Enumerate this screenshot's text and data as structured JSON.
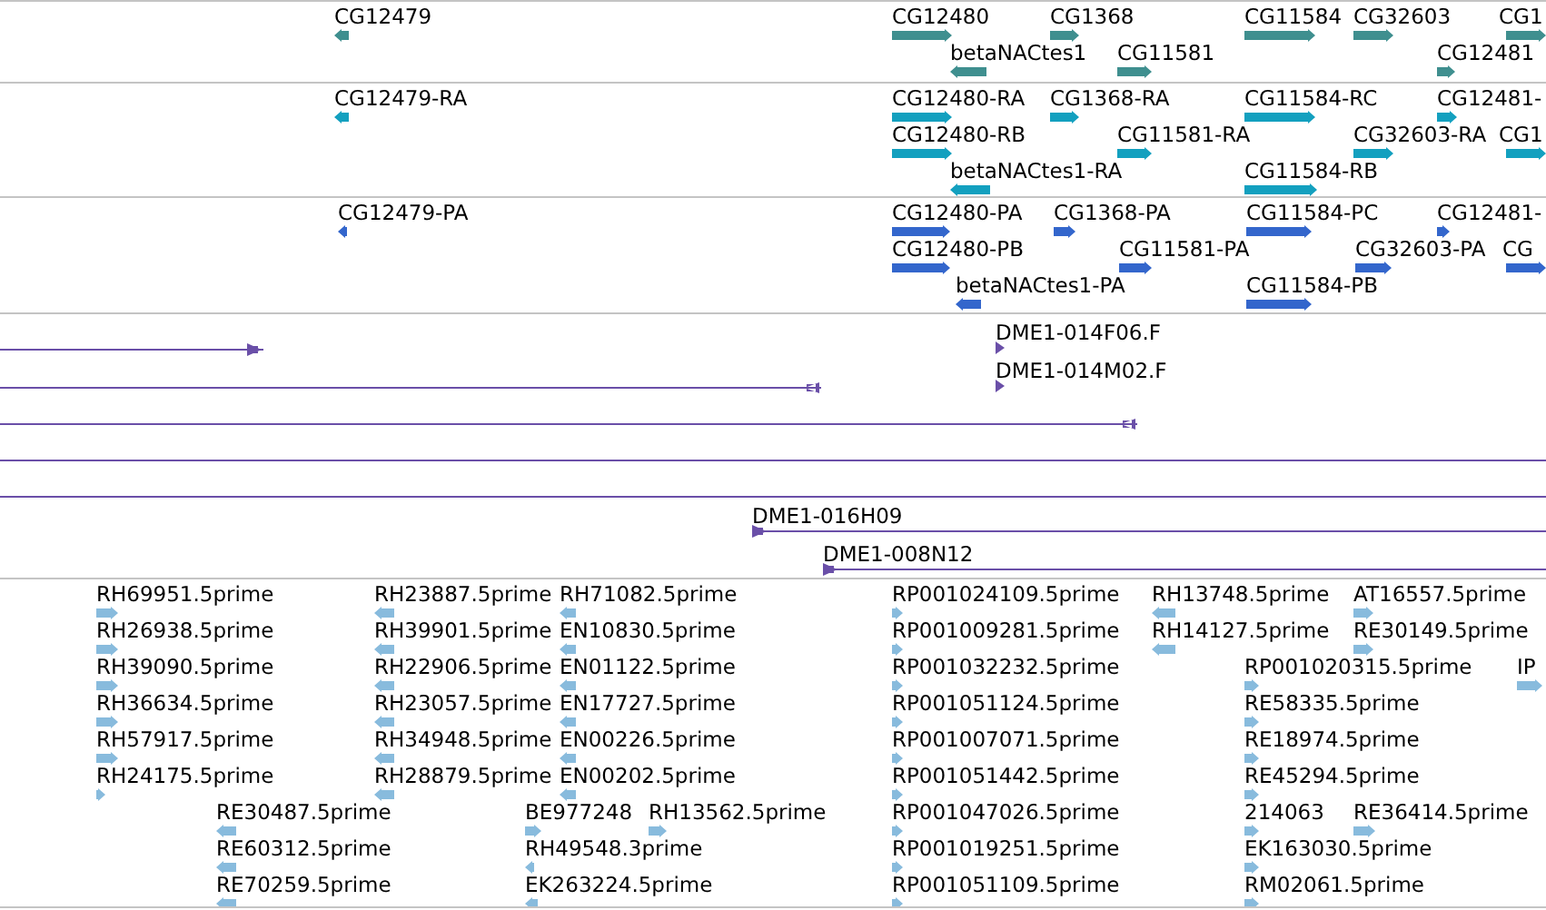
{
  "tracks": [
    {
      "kind": "gene",
      "color": "#3f8f8f",
      "features": [
        {
          "label": "CG12479",
          "reverse": true
        },
        {
          "label": "CG12480",
          "reverse": false
        },
        {
          "label": "CG1368",
          "reverse": false
        },
        {
          "label": "CG11584",
          "reverse": false
        },
        {
          "label": "CG32603",
          "reverse": false
        },
        {
          "label": "CG1",
          "reverse": false
        },
        {
          "label": "betaNACtes1",
          "reverse": true
        },
        {
          "label": "CG11581",
          "reverse": false
        },
        {
          "label": "CG12481",
          "reverse": false
        }
      ]
    },
    {
      "kind": "gene",
      "color": "#13a0bf",
      "features": [
        {
          "label": "CG12479-RA",
          "reverse": true
        },
        {
          "label": "CG12480-RA",
          "reverse": false
        },
        {
          "label": "CG1368-RA",
          "reverse": false
        },
        {
          "label": "CG11584-RC",
          "reverse": false
        },
        {
          "label": "CG12481-",
          "reverse": false
        },
        {
          "label": "CG12480-RB",
          "reverse": false
        },
        {
          "label": "CG11581-RA",
          "reverse": false
        },
        {
          "label": "CG32603-RA",
          "reverse": false
        },
        {
          "label": "CG1",
          "reverse": false
        },
        {
          "label": "betaNACtes1-RA",
          "reverse": true
        },
        {
          "label": "CG11584-RB",
          "reverse": false
        }
      ]
    },
    {
      "kind": "gene",
      "color": "#3366cc",
      "features": [
        {
          "label": "CG12479-PA",
          "reverse": true
        },
        {
          "label": "CG12480-PA",
          "reverse": false
        },
        {
          "label": "CG1368-PA",
          "reverse": false
        },
        {
          "label": "CG11584-PC",
          "reverse": false
        },
        {
          "label": "CG12481-",
          "reverse": false
        },
        {
          "label": "CG12480-PB",
          "reverse": false
        },
        {
          "label": "CG11581-PA",
          "reverse": false
        },
        {
          "label": "CG32603-PA",
          "reverse": false
        },
        {
          "label": "CG",
          "reverse": false
        },
        {
          "label": "betaNACtes1-PA",
          "reverse": true
        },
        {
          "label": "CG11584-PB",
          "reverse": false
        }
      ]
    },
    {
      "kind": "clone",
      "color": "#6a4fa8",
      "features": [
        {
          "head": true,
          "reverse": false
        },
        {
          "label": "DME1-014F06.F",
          "head": true,
          "reverse": false
        },
        {
          "head": true,
          "reverse": true
        },
        {
          "label": "DME1-014M02.F",
          "head": true,
          "reverse": false
        },
        {
          "head": true,
          "reverse": true
        },
        {
          "head": false
        },
        {
          "head": false
        },
        {
          "label": "DME1-016H09",
          "head": true,
          "reverse": false
        },
        {
          "label": "DME1-008N12",
          "head": true,
          "reverse": false
        }
      ]
    },
    {
      "kind": "gene",
      "color": "#88bbdd",
      "features": [
        {
          "label": "RH69951.5prime",
          "reverse": false
        },
        {
          "label": "RH23887.5prime",
          "reverse": true
        },
        {
          "label": "RH71082.5prime",
          "reverse": true
        },
        {
          "label": "RP001024109.5prime",
          "reverse": false
        },
        {
          "label": "RH13748.5prime",
          "reverse": true
        },
        {
          "label": "AT16557.5prime",
          "reverse": false
        },
        {
          "label": "RH26938.5prime",
          "reverse": false
        },
        {
          "label": "RH39901.5prime",
          "reverse": true
        },
        {
          "label": "EN10830.5prime",
          "reverse": true
        },
        {
          "label": "RP001009281.5prime",
          "reverse": false
        },
        {
          "label": "RH14127.5prime",
          "reverse": true
        },
        {
          "label": "RE30149.5prime",
          "reverse": false
        },
        {
          "label": "RH39090.5prime",
          "reverse": false
        },
        {
          "label": "RH22906.5prime",
          "reverse": true
        },
        {
          "label": "EN01122.5prime",
          "reverse": true
        },
        {
          "label": "RP001032232.5prime",
          "reverse": false
        },
        {
          "label": "RP001020315.5prime",
          "reverse": false
        },
        {
          "label": "IP",
          "reverse": false
        },
        {
          "label": "RH36634.5prime",
          "reverse": false
        },
        {
          "label": "RH23057.5prime",
          "reverse": true
        },
        {
          "label": "EN17727.5prime",
          "reverse": true
        },
        {
          "label": "RP001051124.5prime",
          "reverse": false
        },
        {
          "label": "RE58335.5prime",
          "reverse": false
        },
        {
          "label": "RH57917.5prime",
          "reverse": false
        },
        {
          "label": "RH34948.5prime",
          "reverse": true
        },
        {
          "label": "EN00226.5prime",
          "reverse": true
        },
        {
          "label": "RP001007071.5prime",
          "reverse": false
        },
        {
          "label": "RE18974.5prime",
          "reverse": false
        },
        {
          "label": "RH24175.5prime",
          "reverse": false
        },
        {
          "label": "RH28879.5prime",
          "reverse": true
        },
        {
          "label": "EN00202.5prime",
          "reverse": true
        },
        {
          "label": "RP001051442.5prime",
          "reverse": false
        },
        {
          "label": "RE45294.5prime",
          "reverse": false
        },
        {
          "label": "RE30487.5prime",
          "reverse": true
        },
        {
          "label": "BE977248",
          "reverse": false
        },
        {
          "label": "RH13562.5prime",
          "reverse": false
        },
        {
          "label": "RP001047026.5prime",
          "reverse": false
        },
        {
          "label": "214063",
          "reverse": false
        },
        {
          "label": "RE36414.5prime",
          "reverse": false
        },
        {
          "label": "RE60312.5prime",
          "reverse": true
        },
        {
          "label": "RH49548.3prime",
          "reverse": true
        },
        {
          "label": "RP001019251.5prime",
          "reverse": false
        },
        {
          "label": "EK163030.5prime",
          "reverse": false
        },
        {
          "label": "RE70259.5prime",
          "reverse": true
        },
        {
          "label": "EK263224.5prime",
          "reverse": true
        },
        {
          "label": "RP001051109.5prime",
          "reverse": false
        },
        {
          "label": "RM02061.5prime",
          "reverse": false
        }
      ]
    }
  ]
}
